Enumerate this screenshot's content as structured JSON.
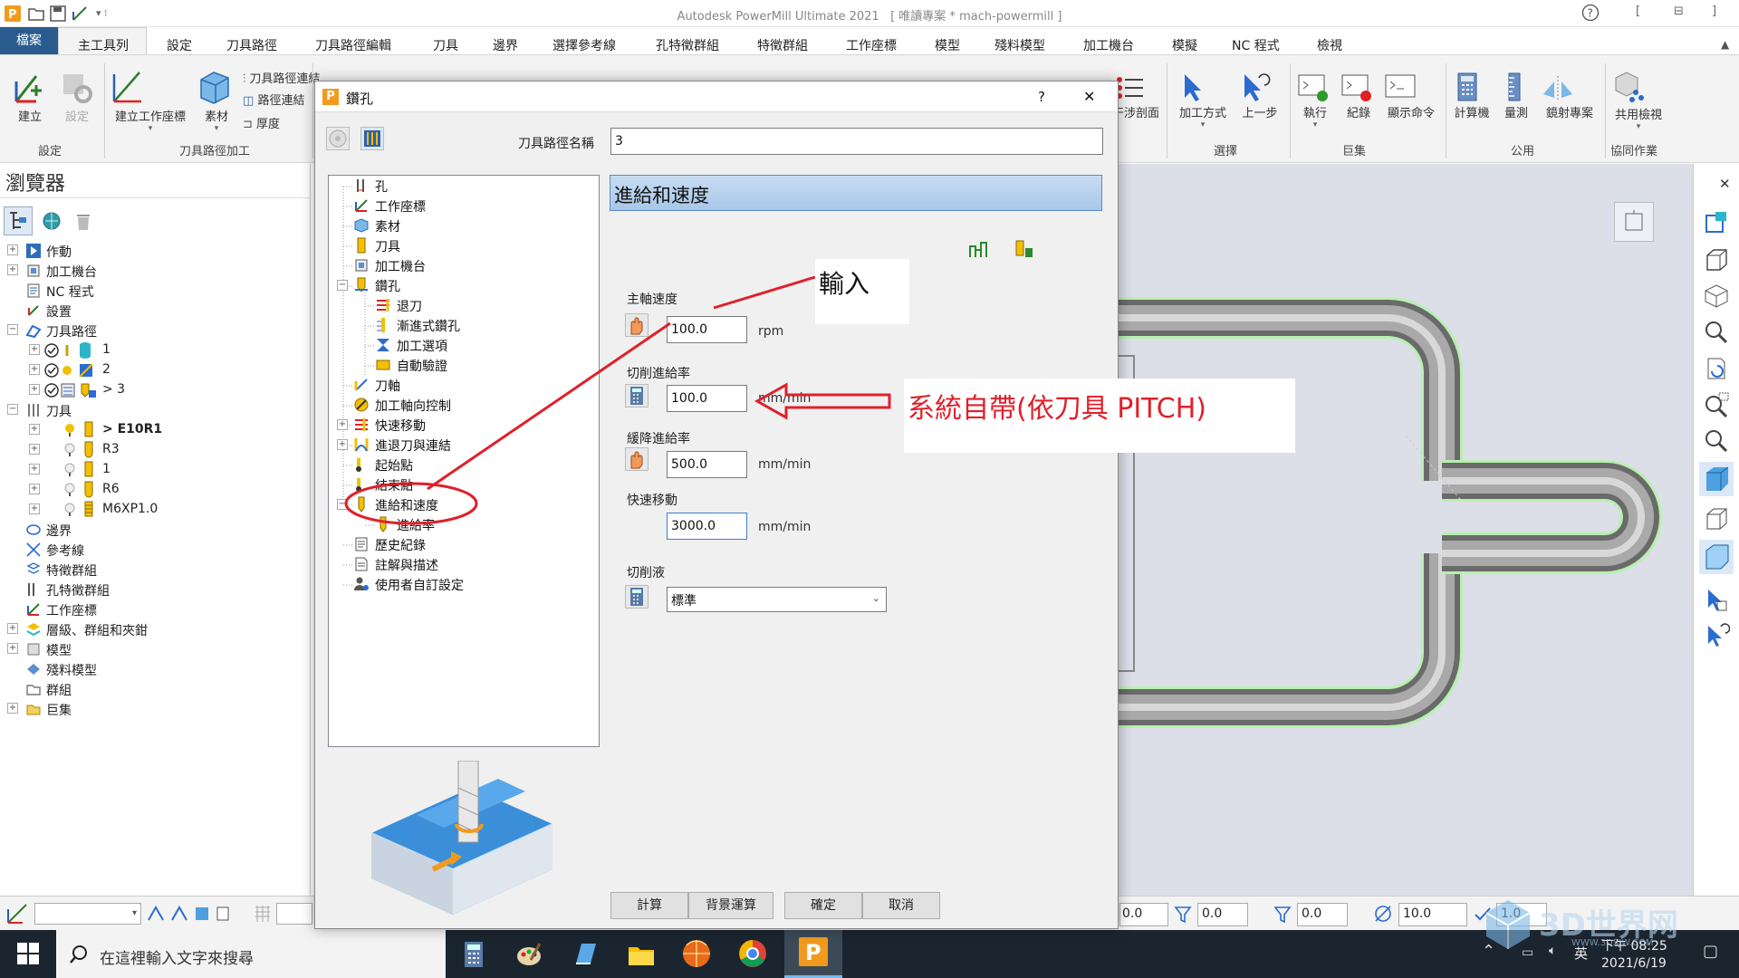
{
  "app": {
    "title": "Autodesk PowerMill Ultimate 2021",
    "project": "[ 唯讀專案 * mach-powermill ]",
    "help": "?",
    "win_controls": [
      "[",
      "⊟",
      "]"
    ]
  },
  "ribbon": {
    "tabs": [
      "檔案",
      "主工具列",
      "設定",
      "刀具路徑",
      "刀具路徑編輯",
      "刀具",
      "邊界",
      "選擇參考線",
      "孔特徵群組",
      "特徵群組",
      "工作座標",
      "模型",
      "殘料模型",
      "加工機台",
      "模擬",
      "NC 程式",
      "檢視"
    ],
    "buttons": {
      "create": "建立",
      "settings": "設定",
      "create_workplane": "建立工作座標",
      "stock": "素材",
      "toolpath_connections": "刀具路徑連結",
      "path_connect": "路徑連結",
      "thickness": "厚度",
      "section": "干涉剖面",
      "select_method": "加工方式",
      "undo": "上一步",
      "run": "執行",
      "record": "紀錄",
      "show_command": "顯示命令",
      "calculator": "計算機",
      "measure": "量測",
      "mirror": "鏡射專案",
      "shared_view": "共用檢視"
    },
    "groups": [
      "設定",
      "刀具路徑加工",
      "選擇",
      "巨集",
      "公用",
      "協同作業"
    ]
  },
  "browser": {
    "title": "瀏覽器",
    "items": [
      {
        "label": "作動"
      },
      {
        "label": "加工機台"
      },
      {
        "label": "NC 程式"
      },
      {
        "label": "設置"
      },
      {
        "label": "刀具路徑"
      },
      {
        "label": "1"
      },
      {
        "label": "2"
      },
      {
        "label": "> 3"
      },
      {
        "label": "刀具"
      },
      {
        "label": "> E10R1"
      },
      {
        "label": "R3"
      },
      {
        "label": "1"
      },
      {
        "label": "R6"
      },
      {
        "label": "M6XP1.0"
      },
      {
        "label": "邊界"
      },
      {
        "label": "參考線"
      },
      {
        "label": "特徵群組"
      },
      {
        "label": "孔特徵群組"
      },
      {
        "label": "工作座標"
      },
      {
        "label": "層級、群組和夾鉗"
      },
      {
        "label": "模型"
      },
      {
        "label": "殘料模型"
      },
      {
        "label": "群組"
      },
      {
        "label": "巨集"
      }
    ]
  },
  "dialog": {
    "app_glyph": "P",
    "title": "鑽孔",
    "help": "?",
    "close": "✕",
    "toolpath_name_label": "刀具路徑名稱",
    "toolpath_name": "3",
    "tree": [
      "孔",
      "工作座標",
      "素材",
      "刀具",
      "加工機台",
      "鑽孔",
      "退刀",
      "漸進式鑽孔",
      "加工選項",
      "自動驗證",
      "刀軸",
      "加工軸向控制",
      "快速移動",
      "進退刀與連結",
      "起始點",
      "結束點",
      "進給和速度",
      "進給率",
      "歷史紀錄",
      "註解與描述",
      "使用者自訂設定"
    ],
    "section_title": "進給和速度",
    "spindle_label": "主軸速度",
    "spindle_value": "100.0",
    "spindle_unit": "rpm",
    "cut_feed_label": "切削進給率",
    "cut_feed_value": "100.0",
    "cut_feed_unit": "mm/min",
    "plunge_label": "緩降進給率",
    "plunge_value": "500.0",
    "plunge_unit": "mm/min",
    "rapid_label": "快速移動",
    "rapid_value": "3000.0",
    "rapid_unit": "mm/min",
    "coolant_label": "切削液",
    "coolant_value": "標準",
    "buttons": [
      "計算",
      "背景運算",
      "確定",
      "取消"
    ]
  },
  "annotations": {
    "input_note": "輸入",
    "system_note": "系統自帶(依刀具 PITCH)"
  },
  "statusbar": {
    "fields": [
      "0.0",
      "0.0",
      "0.0",
      "10.0",
      "1.0"
    ]
  },
  "taskbar": {
    "search_placeholder": "在這裡輸入文字來搜尋",
    "time": "下午 08:25",
    "date": "2021/6/19",
    "ime": "英",
    "watermark": "3D世界网",
    "watermark_sub": "WWW.3DSJW.COM"
  },
  "colors": {
    "accent": "#2a5b8e",
    "annotation_red": "#e0202a",
    "section_header": "#a7c7e8",
    "viewport_bg": "#dcdee8",
    "taskbar": "#1b2530"
  }
}
